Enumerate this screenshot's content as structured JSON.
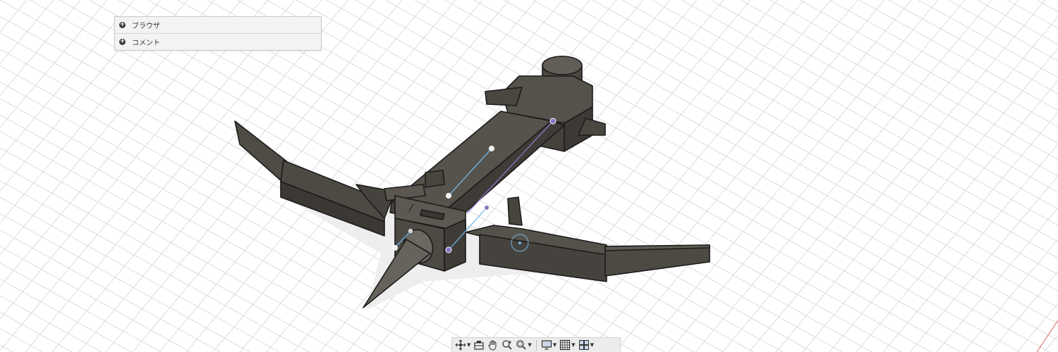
{
  "browser_panel": {
    "rows": [
      {
        "label": "ブラウザ",
        "icon": "plus-circle-icon"
      },
      {
        "label": "コメント",
        "icon": "plus-circle-icon"
      }
    ]
  },
  "model": {
    "body_color": "#4e4b45",
    "edge_color": "#1b1b1b",
    "sketch_line_color": "#6fb6e8",
    "sketch_line_selected_color": "#8a72c4"
  },
  "navigation_toolbar": {
    "tools": [
      {
        "name": "orbit-icon",
        "dropdown": true
      },
      {
        "name": "look-at-icon",
        "dropdown": false
      },
      {
        "name": "pan-hand-icon",
        "dropdown": false
      },
      {
        "name": "zoom-icon",
        "dropdown": false
      },
      {
        "name": "fit-window-zoom-icon",
        "dropdown": true
      },
      {
        "name": "display-settings-icon",
        "dropdown": true
      },
      {
        "name": "grid-settings-icon",
        "dropdown": true
      },
      {
        "name": "viewports-icon",
        "dropdown": true
      }
    ]
  }
}
